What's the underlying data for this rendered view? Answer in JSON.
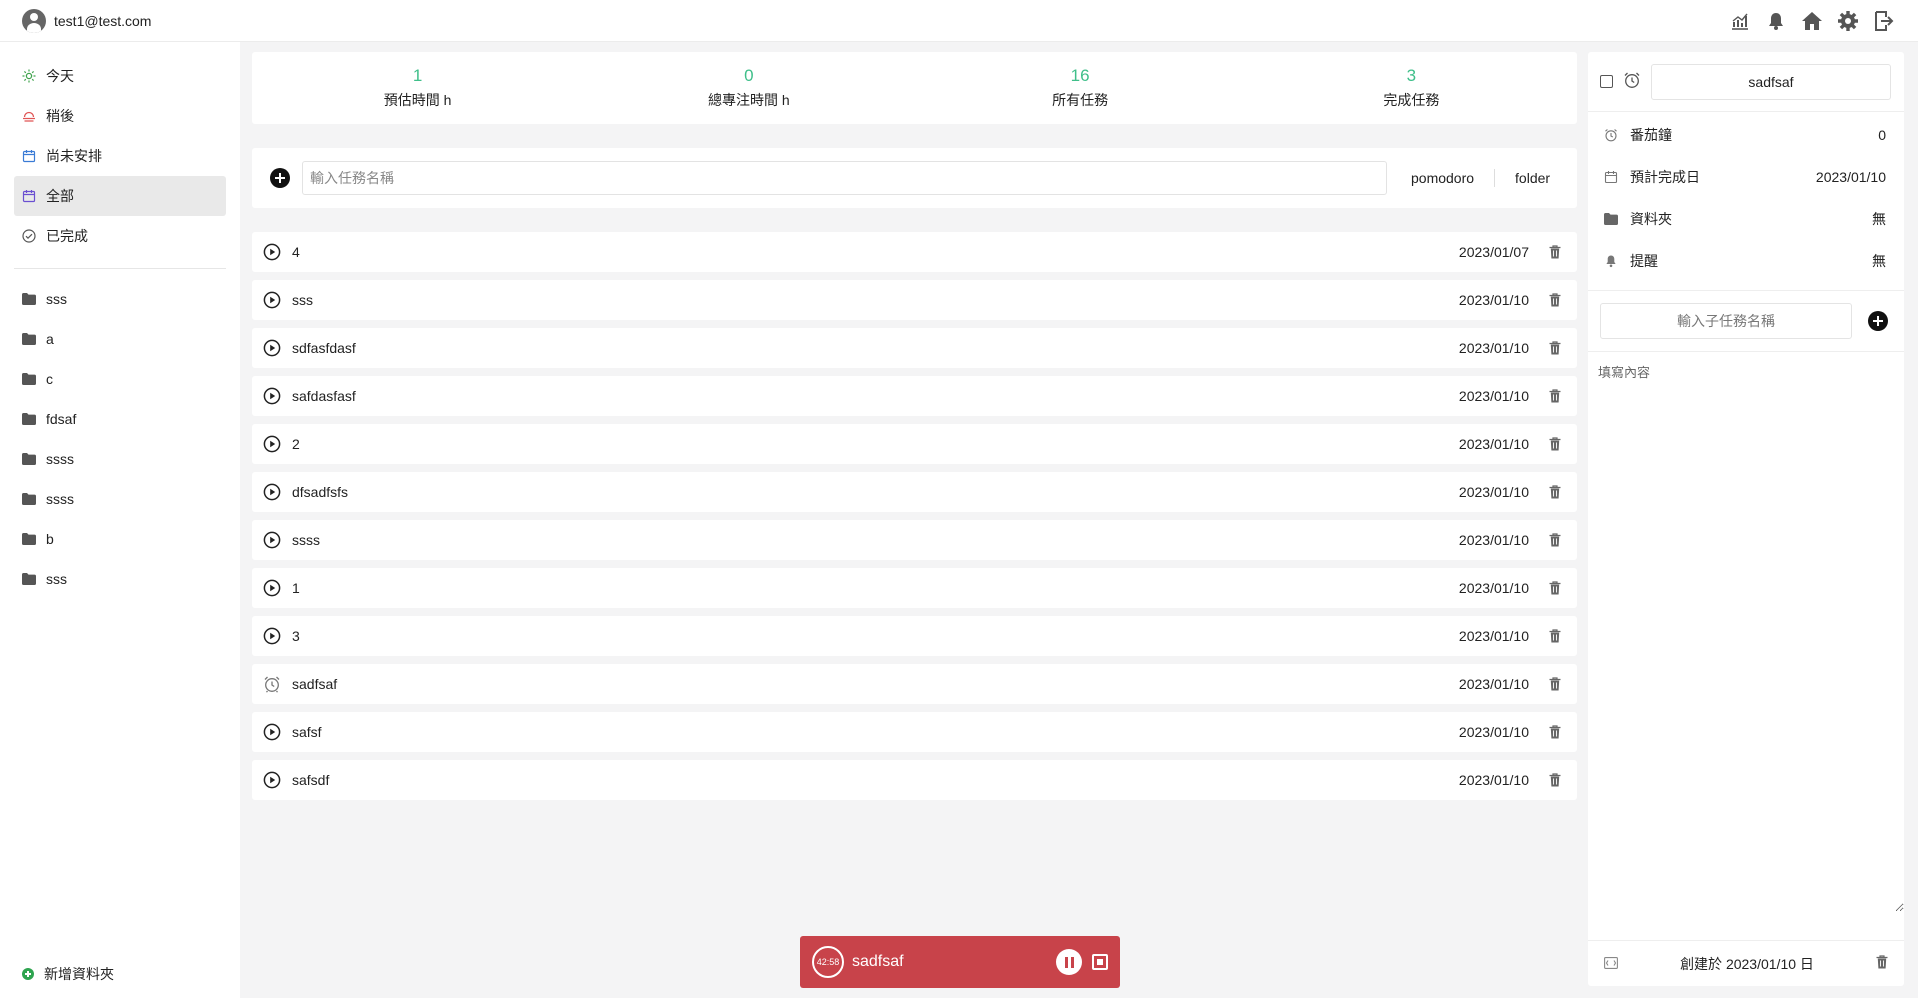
{
  "user": {
    "email": "test1@test.com"
  },
  "header_icons": [
    "chart-icon",
    "bell-icon",
    "home-icon",
    "gear-icon",
    "logout-icon"
  ],
  "nav": {
    "items": [
      {
        "label": "今天",
        "icon": "sun-icon",
        "color": "#3fa34d"
      },
      {
        "label": "稍後",
        "icon": "sunset-icon",
        "color": "#e05555"
      },
      {
        "label": "尚未安排",
        "icon": "calendar-icon",
        "color": "#3a7bd5"
      },
      {
        "label": "全部",
        "icon": "calendar-icon",
        "color": "#6a4fd1",
        "active": true
      },
      {
        "label": "已完成",
        "icon": "check-circle-icon",
        "color": "#555555"
      }
    ]
  },
  "folders": [
    "sss",
    "a",
    "c",
    "fdsaf",
    "ssss",
    "ssss",
    "b",
    "sss"
  ],
  "add_folder_label": "新增資料夾",
  "stats": [
    {
      "value": "1",
      "label": "預估時間 h"
    },
    {
      "value": "0",
      "label": "總專注時間 h"
    },
    {
      "value": "16",
      "label": "所有任務"
    },
    {
      "value": "3",
      "label": "完成任務"
    }
  ],
  "add_task": {
    "placeholder": "輸入任務名稱",
    "pomodoro_label": "pomodoro",
    "folder_label": "folder"
  },
  "tasks": [
    {
      "name": "4",
      "date": "2023/01/07",
      "icon": "play"
    },
    {
      "name": "sss",
      "date": "2023/01/10",
      "icon": "play"
    },
    {
      "name": "sdfasfdasf",
      "date": "2023/01/10",
      "icon": "play"
    },
    {
      "name": "safdasfasf",
      "date": "2023/01/10",
      "icon": "play"
    },
    {
      "name": "2",
      "date": "2023/01/10",
      "icon": "play"
    },
    {
      "name": "dfsadfsfs",
      "date": "2023/01/10",
      "icon": "play"
    },
    {
      "name": "ssss",
      "date": "2023/01/10",
      "icon": "play"
    },
    {
      "name": "1",
      "date": "2023/01/10",
      "icon": "play"
    },
    {
      "name": "3",
      "date": "2023/01/10",
      "icon": "play"
    },
    {
      "name": "sadfsaf",
      "date": "2023/01/10",
      "icon": "alarm"
    },
    {
      "name": "safsf",
      "date": "2023/01/10",
      "icon": "play"
    },
    {
      "name": "safsdf",
      "date": "2023/01/10",
      "icon": "play"
    }
  ],
  "detail": {
    "title": "sadfsaf",
    "props": [
      {
        "label": "番茄鐘",
        "value": "0",
        "icon": "alarm-icon"
      },
      {
        "label": "預計完成日",
        "value": "2023/01/10",
        "icon": "calendar-icon"
      },
      {
        "label": "資料夾",
        "value": "無",
        "icon": "folder-icon"
      },
      {
        "label": "提醒",
        "value": "無",
        "icon": "bell-icon"
      }
    ],
    "subtask_placeholder": "輸入子任務名稱",
    "notes_placeholder": "填寫內容",
    "created": "創建於 2023/01/10 日"
  },
  "pomodoro": {
    "time": "42:58",
    "title": "sadfsaf"
  },
  "colors": {
    "accent_green": "#3fbf8a",
    "pomodoro_red": "#c8434a"
  }
}
